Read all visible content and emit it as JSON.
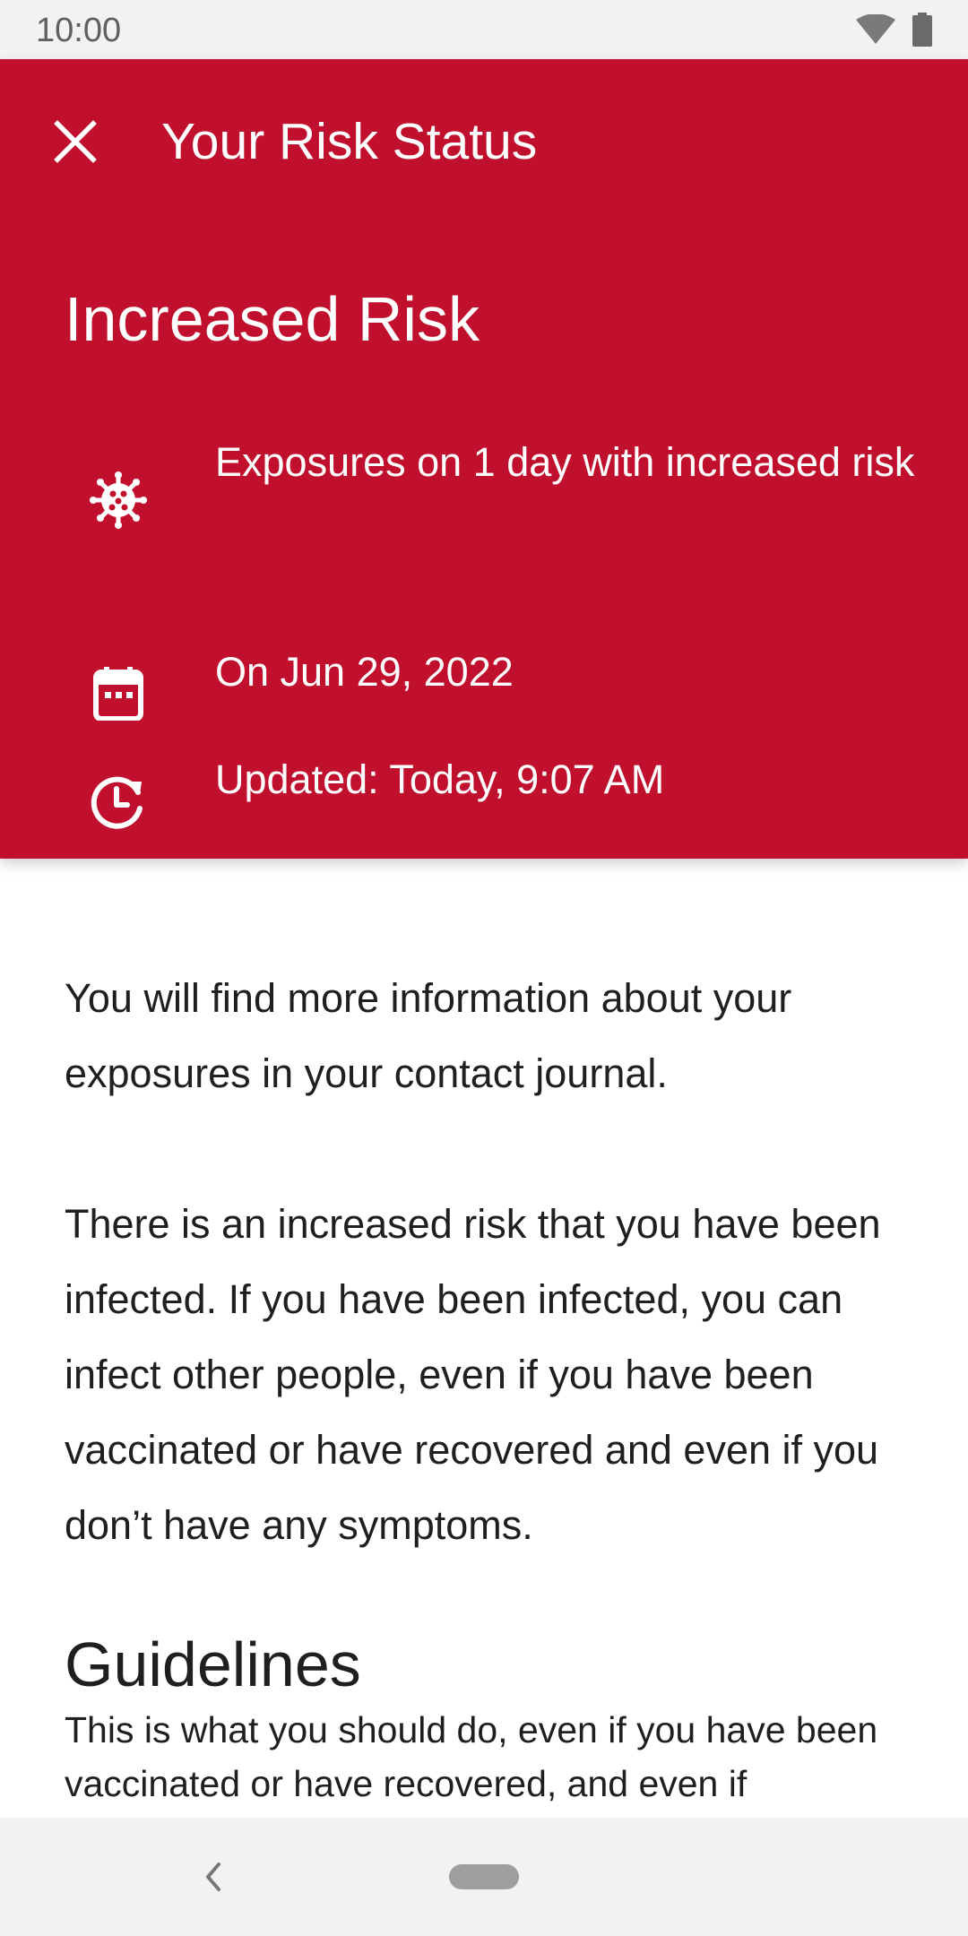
{
  "status_bar": {
    "time": "10:00",
    "icons": [
      "wifi-icon",
      "battery-icon"
    ]
  },
  "toolbar": {
    "close_icon": "close-icon",
    "title": "Your Risk Status"
  },
  "risk": {
    "title": "Increased Risk",
    "accent_color": "#c0102e",
    "details": [
      {
        "icon": "virus-icon",
        "text": "Exposures on 1 day with increased risk"
      },
      {
        "icon": "calendar-icon",
        "text": "On Jun 29, 2022"
      },
      {
        "icon": "history-clock-icon",
        "text": "Updated: Today, 9:07 AM"
      }
    ]
  },
  "content": {
    "paragraph_1": "You will find more information about your exposures in your contact journal.",
    "paragraph_2": "There is an increased risk that you have been infected. If you have been infected, you can infect other people, even if you have been vaccinated or have recovered and even if you don’t have any symptoms.",
    "guidelines_heading": "Guidelines",
    "guidelines_text": "This is what you should do, even if you have been vaccinated or have recovered, and even if"
  },
  "nav_bar": {
    "icons": [
      "back-icon",
      "home-pill"
    ]
  }
}
